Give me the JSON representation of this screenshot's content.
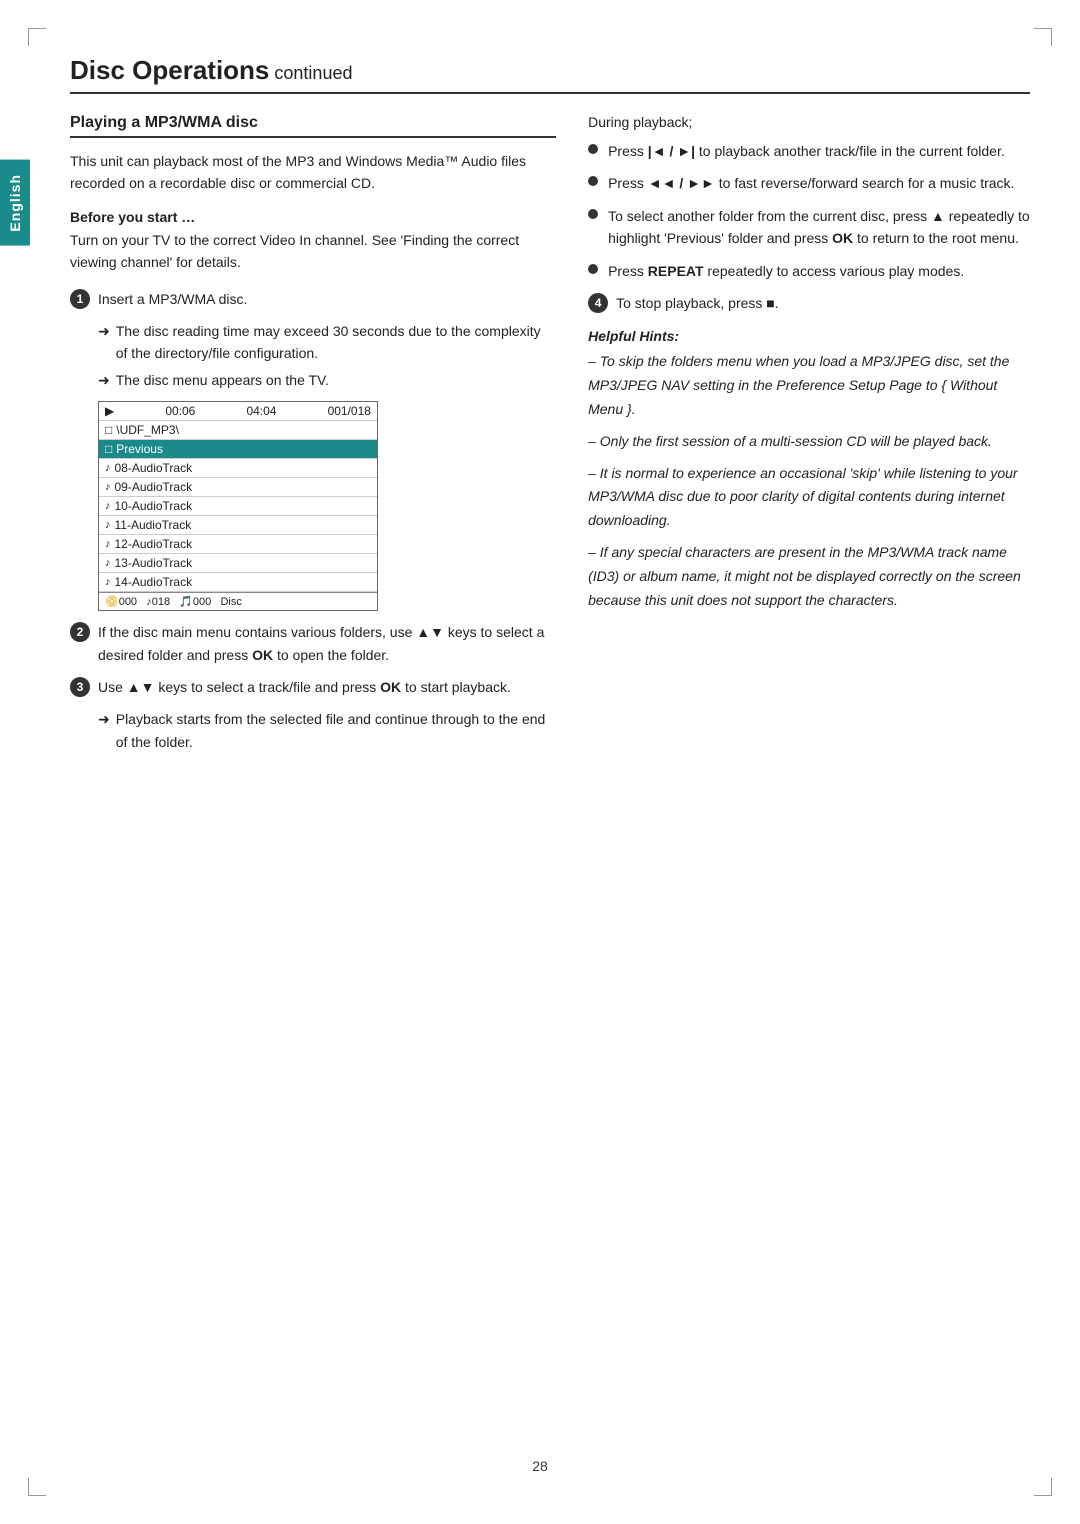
{
  "page": {
    "title": "Disc Operations",
    "title_suffix": " continued",
    "page_number": "28",
    "language_tab": "English"
  },
  "section": {
    "heading": "Playing a MP3/WMA disc",
    "intro": "This unit can playback most of the MP3 and Windows Media™ Audio files recorded on a recordable disc or commercial CD.",
    "before_start_label": "Before you start …",
    "before_start_text": "Turn on your TV to the correct Video In channel. See 'Finding the correct viewing channel' for details.",
    "steps": [
      {
        "num": "1",
        "text": "Insert a MP3/WMA disc.",
        "notes": [
          "The disc reading time may exceed 30 seconds due to the complexity of the directory/file configuration.",
          "The disc menu appears on the TV."
        ]
      },
      {
        "num": "2",
        "text": "If the disc main menu contains various folders, use ▲▼ keys to select a desired folder and press OK to open the folder."
      },
      {
        "num": "3",
        "text": "Use ▲▼ keys to select a track/file and press OK to start playback.",
        "notes": [
          "Playback starts from the selected file and continue through to the end of the folder."
        ]
      },
      {
        "num": "4",
        "text": "To stop playback, press ■."
      }
    ],
    "screen": {
      "header": {
        "time1": "00:06",
        "time2": "04:04",
        "track": "001/018"
      },
      "path_row": "\\UDF_MP3\\",
      "rows": [
        {
          "label": "Previous",
          "selected": true
        },
        {
          "label": "08-AudioTrack",
          "selected": false
        },
        {
          "label": "09-AudioTrack",
          "selected": false
        },
        {
          "label": "10-AudioTrack",
          "selected": false
        },
        {
          "label": "11-AudioTrack",
          "selected": false
        },
        {
          "label": "12-AudioTrack",
          "selected": false
        },
        {
          "label": "13-AudioTrack",
          "selected": false
        },
        {
          "label": "14-AudioTrack",
          "selected": false
        }
      ],
      "footer": "000   018   000   Disc"
    },
    "during_playback": "During playback;",
    "bullets": [
      "Press |◄ / ►| to playback another track/file in the current folder.",
      "Press ◄◄ / ►► to fast reverse/forward search for a music track.",
      "To select another folder from the current disc, press ▲ repeatedly to highlight 'Previous' folder and press OK to return to the root menu.",
      "Press REPEAT repeatedly to access various play modes."
    ],
    "helpful_hints_title": "Helpful Hints:",
    "hints": [
      "– To skip the folders menu when you load a MP3/JPEG disc, set the MP3/JPEG NAV setting in the Preference Setup Page to { Without Menu }.",
      "– Only the first session of a multi-session CD will be played back.",
      "– It is normal to experience an occasional 'skip' while listening to your MP3/WMA disc due to poor clarity of digital contents during internet downloading.",
      "– If any special characters are present in the MP3/WMA track name (ID3) or album name, it might not be displayed correctly on the screen because this unit does not support the characters."
    ]
  }
}
